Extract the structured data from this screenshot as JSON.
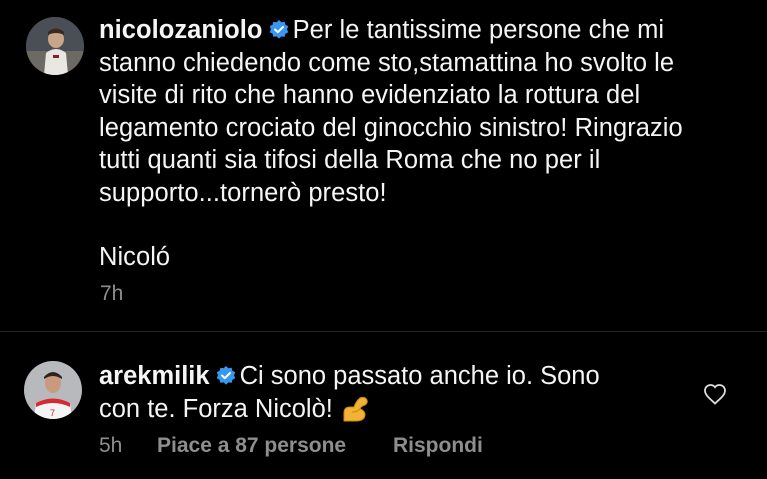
{
  "post": {
    "username": "nicolozaniolo",
    "lines": [
      "Per le tantissime persone che mi",
      "stanno chiedendo come sto,stamattina ho svolto le",
      "visite di rito che hanno evidenziato la rottura del",
      "legamento crociato del ginocchio sinistro! Ringrazio",
      "tutti quanti sia tifosi della Roma che no per il",
      "supporto...tornerò presto!"
    ],
    "signature": "Nicoló",
    "time": "7h"
  },
  "comment": {
    "username": "arekmilik",
    "text_line1": "Ci sono passato anche io. Sono",
    "text_line2": "con te. Forza Nicolò!",
    "emoji": "flexed-biceps-icon",
    "time": "5h",
    "likes": "Piace a 87 persone",
    "reply": "Rispondi"
  },
  "colors": {
    "background": "#000000",
    "text": "#f5f5f5",
    "muted": "#8e8e8e",
    "verified": "#3897f0"
  }
}
